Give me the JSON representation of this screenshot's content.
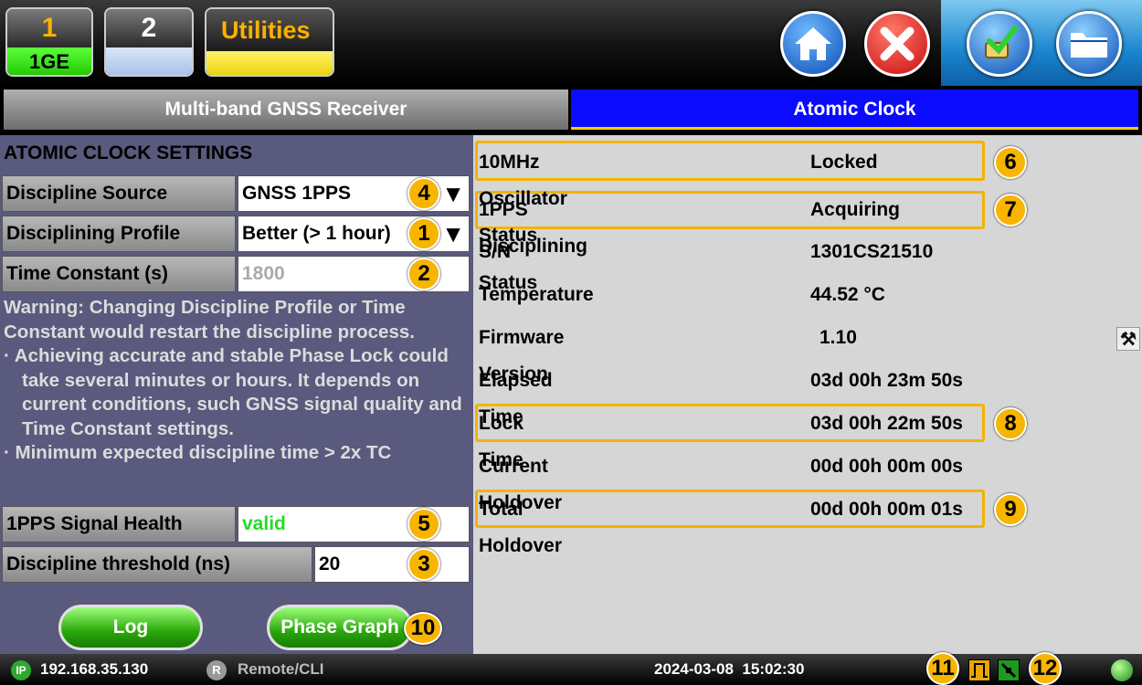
{
  "header": {
    "port1": {
      "number": "1",
      "label": "1GE"
    },
    "port2": {
      "number": "2",
      "label": ""
    },
    "utilities_label": "Utilities",
    "icons": [
      "home-icon",
      "close-icon",
      "tool-check-icon",
      "folder-icon"
    ]
  },
  "tabs": [
    {
      "label": "Multi-band GNSS Receiver",
      "active": false
    },
    {
      "label": "Atomic Clock",
      "active": true
    }
  ],
  "settings": {
    "title": "ATOMIC CLOCK SETTINGS",
    "discipline_source": {
      "label": "Discipline Source",
      "value": "GNSS 1PPS"
    },
    "disciplining_profile": {
      "label": "Disciplining Profile",
      "value": "Better (> 1 hour)"
    },
    "time_constant": {
      "label": "Time Constant (s)",
      "value": "1800"
    },
    "warning": {
      "line1": "Warning: Changing Discipline Profile or Time Constant would restart the discipline process.",
      "bullet1": "· Achieving accurate and stable Phase Lock could take several minutes or hours. It depends on current conditions, such GNSS signal quality and Time Constant settings.",
      "bullet2": "· Minimum expected discipline time > 2x TC"
    },
    "signal_health": {
      "label": "1PPS Signal Health",
      "value": "valid"
    },
    "discipline_threshold": {
      "label": "Discipline threshold (ns)",
      "value": "20"
    },
    "log_button": "Log",
    "phase_graph_button": "Phase Graph"
  },
  "status": [
    {
      "key": "10MHz Oscillator Status",
      "value": "Locked"
    },
    {
      "key": "1PPS Disciplining Status",
      "value": "Acquiring"
    },
    {
      "key": "S/N",
      "value": "1301CS21510"
    },
    {
      "key": "Temperature",
      "value": "44.52 °C"
    },
    {
      "key": "Firmware Version",
      "value": "1.10"
    },
    {
      "key": "Elapsed Time",
      "value": "03d 00h 23m 50s"
    },
    {
      "key": "Lock Time",
      "value": "03d 00h 22m 50s"
    },
    {
      "key": "Current Holdover",
      "value": "00d 00h 00m 00s"
    },
    {
      "key": "Total Holdover",
      "value": "00d 00h 00m 01s"
    }
  ],
  "callouts": [
    "1",
    "2",
    "3",
    "4",
    "5",
    "6",
    "7",
    "8",
    "9",
    "10",
    "11",
    "12"
  ],
  "statusbar": {
    "ip_icon": "IP",
    "ip": "192.168.35.130",
    "remote_icon": "R",
    "remote": "Remote/CLI",
    "datetime": "2024-03-08  15:02:30"
  },
  "colors": {
    "accent": "#f7b500",
    "active_tab": "#0b0bff",
    "valid_text": "#22dd22"
  }
}
